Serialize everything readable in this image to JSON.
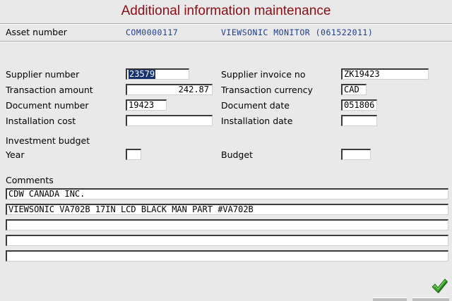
{
  "window": {
    "title": "Additional information maintenance"
  },
  "asset": {
    "label": "Asset number",
    "number": "COM0000117",
    "description": "VIEWSONIC MONITOR (061522011)"
  },
  "fields": {
    "supplier_number": {
      "label": "Supplier number",
      "value": "23579"
    },
    "supplier_invoice_no": {
      "label": "Supplier invoice no",
      "value": "ZK19423"
    },
    "transaction_amount": {
      "label": "Transaction amount",
      "value": "242.87"
    },
    "transaction_currency": {
      "label": "Transaction currency",
      "value": "CAD"
    },
    "document_number": {
      "label": "Document number",
      "value": "19423"
    },
    "document_date": {
      "label": "Document date",
      "value": "051806"
    },
    "installation_cost": {
      "label": "Installation cost",
      "value": ""
    },
    "installation_date": {
      "label": "Installation date",
      "value": ""
    }
  },
  "investment_budget": {
    "heading": "Investment budget",
    "year_label": "Year",
    "year_value": "",
    "budget_label": "Budget",
    "budget_value": ""
  },
  "comments": {
    "label": "Comments",
    "lines": [
      "CDW CANADA INC.",
      "VIEWSONIC VA702B 17IN LCD BLACK MAN PART #VA702B",
      "",
      "",
      ""
    ]
  },
  "icons": {
    "confirm": "checkmark-icon"
  },
  "colors": {
    "title": "#8b0d16",
    "asset_text": "#1c3d8f",
    "selection": "#16326e",
    "checkmark": "#3aa02c"
  }
}
